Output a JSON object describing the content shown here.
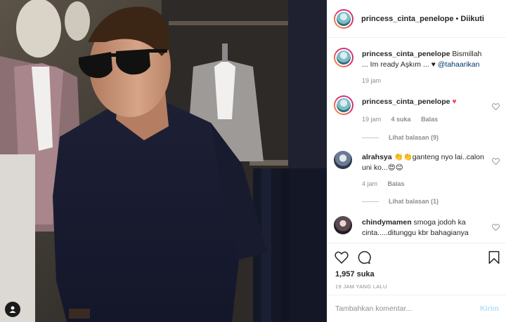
{
  "header": {
    "username": "princess_cinta_penelope",
    "separator": "•",
    "follow_label": "Diikuti"
  },
  "caption": {
    "username": "princess_cinta_penelope",
    "text": " Bismillah ... Im ready Aşkım ... ",
    "heart": "♥",
    "mention": "@tahaarikan",
    "time": "19 jam"
  },
  "comments": [
    {
      "username": "princess_cinta_penelope",
      "text": " ",
      "emoji": "♥",
      "time": "19 jam",
      "likes": "4 suka",
      "reply_label": "Balas",
      "view_replies": "Lihat balasan (9)"
    },
    {
      "username": "alrahsya",
      "emoji_prefix": "👏👏",
      "text": "ganteng nyo lai..calon uni ko...",
      "emoji_suffix": "😍😊",
      "time": "4 jam",
      "reply_label": "Balas",
      "view_replies": "Lihat balasan (1)"
    },
    {
      "username": "chindymamen",
      "text": " smoga jodoh ka cinta.....ditunggu kbr bahagianya"
    }
  ],
  "actions": {
    "likes": "1,957 suka",
    "timestamp": "19 JAM YANG LALU",
    "like_icon": "heart-icon",
    "comment_icon": "comment-icon",
    "save_icon": "bookmark-icon"
  },
  "add_comment": {
    "placeholder": "Tambahkan komentar...",
    "post_label": "Kirim"
  },
  "colors": {
    "accent_link": "#00376b",
    "heart_red": "#ed4956",
    "post_disabled": "#b2dffc",
    "muted": "#8e8e8e"
  }
}
